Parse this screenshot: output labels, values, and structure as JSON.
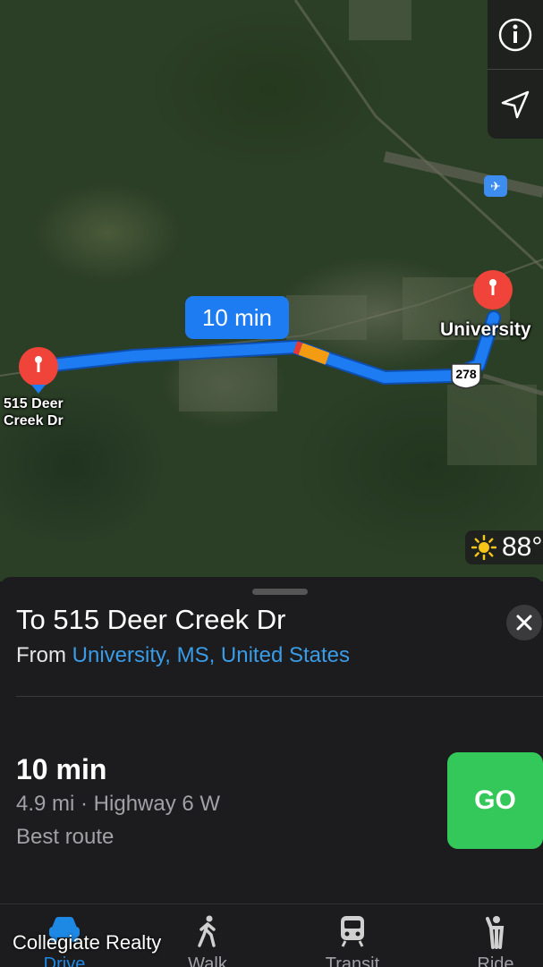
{
  "map": {
    "route_time": "10 min",
    "origin_label": "University",
    "destination_label": "515 Deer\nCreek Dr",
    "highway_shield": "278",
    "weather_temp": "88°",
    "weather_icon": "sun-icon",
    "airport_icon": "airplane-icon",
    "controls": {
      "info_icon": "info-icon",
      "location_icon": "location-arrow-icon"
    },
    "route_color": "#1e7cf2",
    "traffic_color": "#f39c12"
  },
  "sheet": {
    "title": "To 515 Deer Creek Dr",
    "from_prefix": "From ",
    "from_place": "University, MS, United States",
    "route": {
      "time": "10 min",
      "detail": "4.9 mi · Highway 6 W",
      "note": "Best route"
    },
    "go_label": "GO",
    "go_color": "#34c759"
  },
  "tabs": [
    {
      "label": "Drive",
      "icon": "car-icon",
      "active": true
    },
    {
      "label": "Walk",
      "icon": "walk-icon",
      "active": false
    },
    {
      "label": "Transit",
      "icon": "train-icon",
      "active": false
    },
    {
      "label": "Ride",
      "icon": "ride-icon",
      "active": false
    }
  ],
  "watermark": "Collegiate Realty"
}
